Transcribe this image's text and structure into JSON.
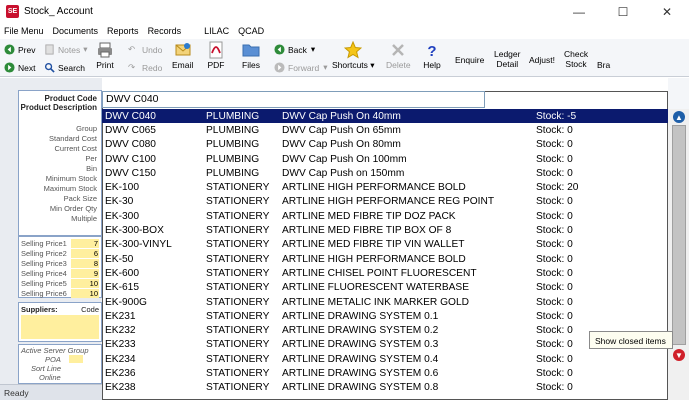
{
  "window": {
    "title": "Stock_ Account",
    "app_icon_text": "SE",
    "minimize": "—",
    "maximize": "☐",
    "close": "✕"
  },
  "menu": [
    "File Menu",
    "Documents",
    "Reports",
    "Records",
    "LILAC",
    "QCAD"
  ],
  "toolbar": {
    "prev": "Prev",
    "next": "Next",
    "notes": "Notes",
    "search": "Search",
    "undo": "Undo",
    "redo": "Redo",
    "print": "Print",
    "email": "Email",
    "pdf": "PDF",
    "files": "Files",
    "back": "Back",
    "forward": "Forward",
    "shortcuts": "Shortcuts",
    "delete": "Delete",
    "help": "Help",
    "enquire": "Enquire",
    "ledger_1": "Ledger",
    "ledger_2": "Detail",
    "adjust": "Adjust!",
    "check_1": "Check",
    "check_2": "Stock",
    "extra": "Bra"
  },
  "left_panel": {
    "product_code": "Product Code",
    "product_description": "Product Description",
    "fields": [
      "Group",
      "Standard Cost",
      "Current Cost",
      "Per",
      "Bin",
      "Minimum Stock",
      "Maximum Stock",
      "Pack Size",
      "Min Order Qty",
      "Multiple"
    ],
    "selling_prices": [
      {
        "label": "Selling Price1",
        "value": "7"
      },
      {
        "label": "Selling Price2",
        "value": "6"
      },
      {
        "label": "Selling Price3",
        "value": "8"
      },
      {
        "label": "Selling Price4",
        "value": "9"
      },
      {
        "label": "Selling Price5",
        "value": "10"
      },
      {
        "label": "Selling Price6",
        "value": "10"
      }
    ],
    "suppliers": "Suppliers:",
    "suppliers_code": "Code",
    "active_server_group": "Active Server Group",
    "poa": "POA",
    "sort_line": "Sort Line",
    "online": "Online"
  },
  "status": "Ready",
  "search": {
    "value": "DWV C040"
  },
  "items": [
    {
      "code": "DWV C040",
      "category": "PLUMBING",
      "description": "DWV Cap Push On 40mm",
      "stock": "Stock: -5"
    },
    {
      "code": "DWV C065",
      "category": "PLUMBING",
      "description": "DWV Cap Push On 65mm",
      "stock": "Stock: 0"
    },
    {
      "code": "DWV C080",
      "category": "PLUMBING",
      "description": "DWV Cap Push On 80mm",
      "stock": "Stock: 0"
    },
    {
      "code": "DWV C100",
      "category": "PLUMBING",
      "description": "DWV Cap Push On 100mm",
      "stock": "Stock: 0"
    },
    {
      "code": "DWV C150",
      "category": "PLUMBING",
      "description": "DWV Cap Push on 150mm",
      "stock": "Stock: 0"
    },
    {
      "code": "EK-100",
      "category": "STATIONERY",
      "description": "ARTLINE HIGH PERFORMANCE BOLD",
      "stock": "Stock: 20"
    },
    {
      "code": "EK-30",
      "category": "STATIONERY",
      "description": "ARTLINE HIGH PERFORMANCE REG POINT",
      "stock": "Stock: 0"
    },
    {
      "code": "EK-300",
      "category": "STATIONERY",
      "description": "ARTLINE MED FIBRE TIP DOZ PACK",
      "stock": "Stock: 0"
    },
    {
      "code": "EK-300-BOX",
      "category": "STATIONERY",
      "description": "ARTLINE MED FIBRE TIP BOX OF 8",
      "stock": "Stock: 0"
    },
    {
      "code": "EK-300-VINYL",
      "category": "STATIONERY",
      "description": "ARTLINE MED FIBRE TIP VIN WALLET",
      "stock": "Stock: 0"
    },
    {
      "code": "EK-50",
      "category": "STATIONERY",
      "description": "ARTLINE HIGH PERFORMANCE BOLD",
      "stock": "Stock: 0"
    },
    {
      "code": "EK-600",
      "category": "STATIONERY",
      "description": "ARTLINE CHISEL POINT FLUORESCENT",
      "stock": "Stock: 0"
    },
    {
      "code": "EK-615",
      "category": "STATIONERY",
      "description": "ARTLINE FLUORESCENT WATERBASE",
      "stock": "Stock: 0"
    },
    {
      "code": "EK-900G",
      "category": "STATIONERY",
      "description": "ARTLINE METALIC INK MARKER GOLD",
      "stock": "Stock: 0"
    },
    {
      "code": "EK231",
      "category": "STATIONERY",
      "description": "ARTLINE DRAWING SYSTEM 0.1",
      "stock": "Stock: 0"
    },
    {
      "code": "EK232",
      "category": "STATIONERY",
      "description": "ARTLINE DRAWING SYSTEM 0.2",
      "stock": "Stock: 0"
    },
    {
      "code": "EK233",
      "category": "STATIONERY",
      "description": "ARTLINE DRAWING SYSTEM 0.3",
      "stock": "Stock: 0"
    },
    {
      "code": "EK234",
      "category": "STATIONERY",
      "description": "ARTLINE DRAWING SYSTEM 0.4",
      "stock": "Stock: 0"
    },
    {
      "code": "EK236",
      "category": "STATIONERY",
      "description": "ARTLINE DRAWING SYSTEM 0.6",
      "stock": "Stock: 0"
    },
    {
      "code": "EK238",
      "category": "STATIONERY",
      "description": "ARTLINE DRAWING SYSTEM 0.8",
      "stock": "Stock: 0"
    }
  ],
  "tooltip": "Show closed items",
  "colors": {
    "selection": "#0b1a6e",
    "price_field": "#ffef9e",
    "panel_border": "#8aa3c8"
  }
}
